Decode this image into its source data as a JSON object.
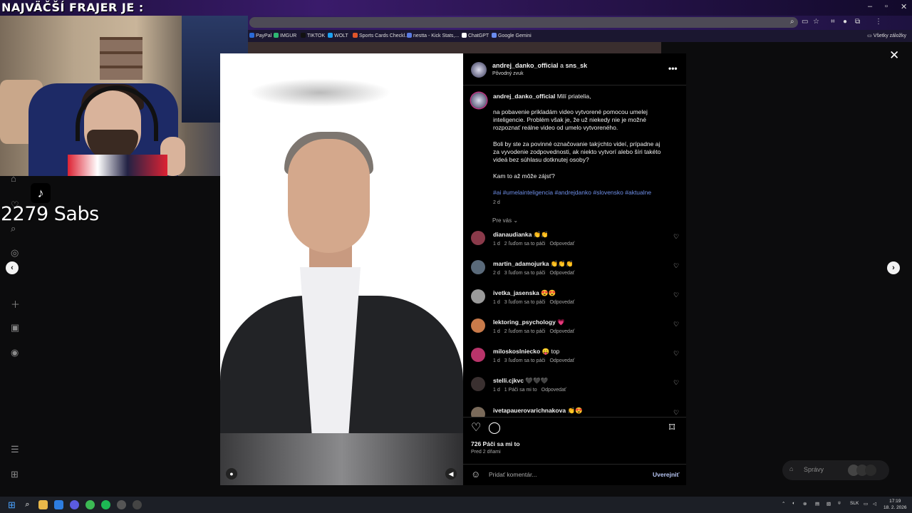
{
  "overlay": {
    "title": "NAJVÄČŠÍ FRAJER JE :",
    "subs": "2279 Sabs"
  },
  "bookmarks": [
    {
      "label": "PayPal",
      "color": "#2a6ad8"
    },
    {
      "label": "IMGUR",
      "color": "#2eb872"
    },
    {
      "label": "TIKTOK",
      "color": "#111111"
    },
    {
      "label": "WOLT",
      "color": "#1da1f2"
    },
    {
      "label": "Sports Cards Checkl...",
      "color": "#e0552a"
    },
    {
      "label": "nestta - Kick Stats,...",
      "color": "#5a7ae0"
    },
    {
      "label": "ChatGPT",
      "color": "#ffffff"
    },
    {
      "label": "Google Gemini",
      "color": "#6a8cf0"
    }
  ],
  "all_bookmarks": "Všetky záložky",
  "post": {
    "author": "andrej_danko_official",
    "connector": "a",
    "coauthor": "sns_sk",
    "audio": "Pôvodný zvuk",
    "caption_user": "andrej_danko_official",
    "caption_p1": "Milí priatelia,",
    "caption_p2": "na pobavenie prikladám video vytvorené pomocou umelej inteligencie. Problém však je, že už niekedy nie je možné rozpoznať reálne video od umelo vytvoreného.",
    "caption_p3": "Boli by ste za povinné označovanie takýchto videí, prípadne aj za vyvodenie zodpovednosti, ak niekto vytvorí alebo šíri takéto videá bez súhlasu dotknutej osoby?",
    "caption_p4": "Kam to až môže zájsť?",
    "hashtags": "#ai #umelainteligencia #andrejdanko #slovensko #aktualne",
    "caption_age": "2 d",
    "filter": "Pre vás",
    "likes": "726 Páči sa mi to",
    "posted": "Pred 2 dňami",
    "add_comment_placeholder": "Pridať komentár...",
    "publish": "Uverejniť"
  },
  "comments": [
    {
      "user": "dianaudianka",
      "text": "👏👏",
      "age": "1 d",
      "likes": "2 ľuďom sa to páči",
      "reply": "Odpovedať",
      "avatar": "#8a3a4a"
    },
    {
      "user": "martin_adamojurka",
      "text": "👏👏👏",
      "age": "2 d",
      "likes": "3 ľuďom sa to páči",
      "reply": "Odpovedať",
      "avatar": "#5a6a7a"
    },
    {
      "user": "ivetka_jasenska",
      "text": "😍😍",
      "age": "1 d",
      "likes": "3 ľuďom sa to páči",
      "reply": "Odpovedať",
      "avatar": "#9a9a9a"
    },
    {
      "user": "lektoring_psychology",
      "text": "💗",
      "age": "1 d",
      "likes": "2 ľuďom sa to páči",
      "reply": "Odpovedať",
      "avatar": "#c87a4a"
    },
    {
      "user": "miloskoslniecko",
      "text": "😛 top",
      "age": "1 d",
      "likes": "3 ľuďom sa to páči",
      "reply": "Odpovedať",
      "avatar": "#b8346a"
    },
    {
      "user": "stelli.cjkvc",
      "text": "🖤🖤🖤",
      "age": "1 d",
      "likes": "1 Páči sa mi to",
      "reply": "Odpovedať",
      "avatar": "#3a3030"
    },
    {
      "user": "ivetapauerovarichnakova",
      "text": "👏😍",
      "age": "",
      "likes": "",
      "reply": "",
      "avatar": "#7a6a5a"
    }
  ],
  "messages": {
    "label": "Správy"
  },
  "taskbar": {
    "lang": "SLK",
    "time": "17:19",
    "date": "18. 2. 2026"
  }
}
